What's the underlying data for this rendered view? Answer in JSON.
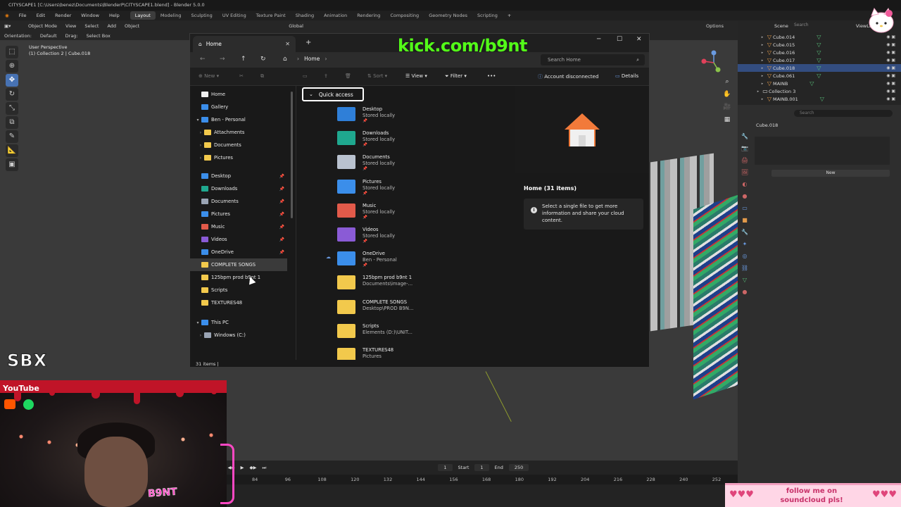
{
  "blender": {
    "title": "CITYSCAPE1 [C:\\Users\\benez\\Documents\\BlenderP\\CITYSCAPE1.blend] - Blender 5.0.0",
    "menu": [
      "File",
      "Edit",
      "Render",
      "Window",
      "Help"
    ],
    "workspaces": [
      "Layout",
      "Modeling",
      "Sculpting",
      "UV Editing",
      "Texture Paint",
      "Shading",
      "Animation",
      "Rendering",
      "Compositing",
      "Geometry Nodes",
      "Scripting"
    ],
    "active_workspace": "Layout",
    "scene": "Scene",
    "view_layer": "ViewLay",
    "header": {
      "mode": "Object Mode",
      "view": "View",
      "select": "Select",
      "add": "Add",
      "object": "Object",
      "orientation_global": "Global",
      "options": "Options"
    },
    "subheader": {
      "orientation_label": "Orientation:",
      "orientation_value": "Default",
      "drag_label": "Drag:",
      "drag_value": "Select Box"
    },
    "viewport": {
      "line1": "User Perspective",
      "line2": "(1) Collection 2 | Cube.018"
    },
    "timeline": {
      "current_frame": "1",
      "start_label": "Start",
      "start": "1",
      "end_label": "End",
      "end": "250",
      "ruler": [
        "84",
        "96",
        "108",
        "120",
        "132",
        "144",
        "156",
        "168",
        "180",
        "192",
        "204",
        "216",
        "228",
        "240",
        "252"
      ]
    },
    "outliner": {
      "search_placeholder": "Search",
      "items": [
        {
          "name": "Cube.014",
          "selected": false
        },
        {
          "name": "Cube.015",
          "selected": false
        },
        {
          "name": "Cube.016",
          "selected": false
        },
        {
          "name": "Cube.017",
          "selected": false
        },
        {
          "name": "Cube.018",
          "selected": true
        },
        {
          "name": "Cube.061",
          "selected": false
        },
        {
          "name": "MAINB",
          "selected": false
        },
        {
          "name": "Collection 3",
          "selected": false
        },
        {
          "name": "MAINB.001",
          "selected": false
        }
      ]
    },
    "properties": {
      "search_placeholder": "Search",
      "object_name": "Cube.018",
      "new_label": "New"
    }
  },
  "explorer": {
    "tab_title": "Home",
    "breadcrumb": "Home",
    "search_placeholder": "Search Home",
    "commands": {
      "new": "New",
      "sort": "Sort",
      "view": "View",
      "filter": "Filter",
      "account": "Account disconnected",
      "details": "Details"
    },
    "sidebar": [
      {
        "label": "Home",
        "icon": "home-icon",
        "color": "#f0f0f0",
        "indent": 1,
        "highlight": false
      },
      {
        "label": "Gallery",
        "icon": "gallery-icon",
        "color": "#3b8eea",
        "indent": 1,
        "highlight": false
      },
      {
        "label": "Ben - Personal",
        "icon": "onedrive-icon",
        "color": "#3b8eea",
        "indent": 0,
        "arrow": "▾",
        "highlight": false
      },
      {
        "label": "Attachments",
        "icon": "folder-icon",
        "color": "#f2c94c",
        "indent": 2,
        "arrow": "›",
        "highlight": false
      },
      {
        "label": "Documents",
        "icon": "folder-icon",
        "color": "#f2c94c",
        "indent": 2,
        "arrow": "›",
        "highlight": false
      },
      {
        "label": "Pictures",
        "icon": "folder-icon",
        "color": "#f2c94c",
        "indent": 2,
        "arrow": "›",
        "highlight": false
      },
      {
        "label": "Desktop",
        "icon": "desktop-icon",
        "color": "#3b8eea",
        "indent": 1,
        "pin": true,
        "highlight": false
      },
      {
        "label": "Downloads",
        "icon": "downloads-icon",
        "color": "#1fa88f",
        "indent": 1,
        "pin": true,
        "highlight": false
      },
      {
        "label": "Documents",
        "icon": "documents-icon",
        "color": "#9aa4b4",
        "indent": 1,
        "pin": true,
        "highlight": false
      },
      {
        "label": "Pictures",
        "icon": "pictures-icon",
        "color": "#3b8eea",
        "indent": 1,
        "pin": true,
        "highlight": false
      },
      {
        "label": "Music",
        "icon": "music-icon",
        "color": "#e25a4a",
        "indent": 1,
        "pin": true,
        "highlight": false
      },
      {
        "label": "Videos",
        "icon": "videos-icon",
        "color": "#8a5bd6",
        "indent": 1,
        "pin": true,
        "highlight": false
      },
      {
        "label": "OneDrive",
        "icon": "onedrive-icon",
        "color": "#3b8eea",
        "indent": 1,
        "pin": true,
        "highlight": false
      },
      {
        "label": "COMPLETE SONGS",
        "icon": "folder-icon",
        "color": "#f2c94c",
        "indent": 1,
        "highlight": true
      },
      {
        "label": "125bpm prod b9nt 1",
        "icon": "folder-icon",
        "color": "#f2c94c",
        "indent": 1,
        "highlight": false
      },
      {
        "label": "Scripts",
        "icon": "folder-icon",
        "color": "#f2c94c",
        "indent": 1,
        "highlight": false
      },
      {
        "label": "TEXTURES48",
        "icon": "folder-icon",
        "color": "#f2c94c",
        "indent": 1,
        "highlight": false
      },
      {
        "label": "This PC",
        "icon": "this-pc-icon",
        "color": "#3b8eea",
        "indent": 0,
        "arrow": "▾",
        "highlight": false
      },
      {
        "label": "Windows (C:)",
        "icon": "drive-icon",
        "color": "#9aa4b4",
        "indent": 2,
        "arrow": "›",
        "highlight": false
      }
    ],
    "quick_access_label": "Quick access",
    "items": [
      {
        "name": "Desktop",
        "sub": "Stored locally",
        "icon": "desktop-icon",
        "color": "#2f7fd8",
        "pin": true
      },
      {
        "name": "Downloads",
        "sub": "Stored locally",
        "icon": "downloads-icon",
        "color": "#1fa88f",
        "pin": true
      },
      {
        "name": "Documents",
        "sub": "Stored locally",
        "icon": "documents-icon",
        "color": "#b9c2cf",
        "pin": true
      },
      {
        "name": "Pictures",
        "sub": "Stored locally",
        "icon": "pictures-icon",
        "color": "#3b8eea",
        "pin": true
      },
      {
        "name": "Music",
        "sub": "Stored locally",
        "icon": "music-icon",
        "color": "#e25a4a",
        "pin": true
      },
      {
        "name": "Videos",
        "sub": "Stored locally",
        "icon": "videos-icon",
        "color": "#8a5bd6",
        "pin": true
      },
      {
        "name": "OneDrive",
        "sub": "Ben - Personal",
        "icon": "onedrive-icon",
        "color": "#3b8eea",
        "pin": true,
        "cloud": true
      },
      {
        "name": "125bpm prod b9nt 1",
        "sub": "Documents\\image-...",
        "icon": "folder-icon",
        "color": "#f2c94c",
        "pin": false
      },
      {
        "name": "COMPLETE SONGS",
        "sub": "Desktop\\PROD B9N...",
        "icon": "folder-icon",
        "color": "#f2c94c",
        "pin": false
      },
      {
        "name": "Scripts",
        "sub": "Elements (D:)\\UNIT...",
        "icon": "folder-icon",
        "color": "#f2c94c",
        "pin": false
      },
      {
        "name": "TEXTURES48",
        "sub": "Pictures",
        "icon": "folder-icon",
        "color": "#f2c94c",
        "pin": false
      }
    ],
    "details": {
      "title": "Home (31 items)",
      "message": "Select a single file to get more information and share your cloud content."
    },
    "status": "31 items  |"
  },
  "overlay": {
    "kick": "kick.com/b9nt",
    "sbx": "SBX",
    "youtube": "YouTube",
    "b9nt_sign": "B9NT",
    "soundcloud_banner": "follow me on soundcloud pls!"
  }
}
